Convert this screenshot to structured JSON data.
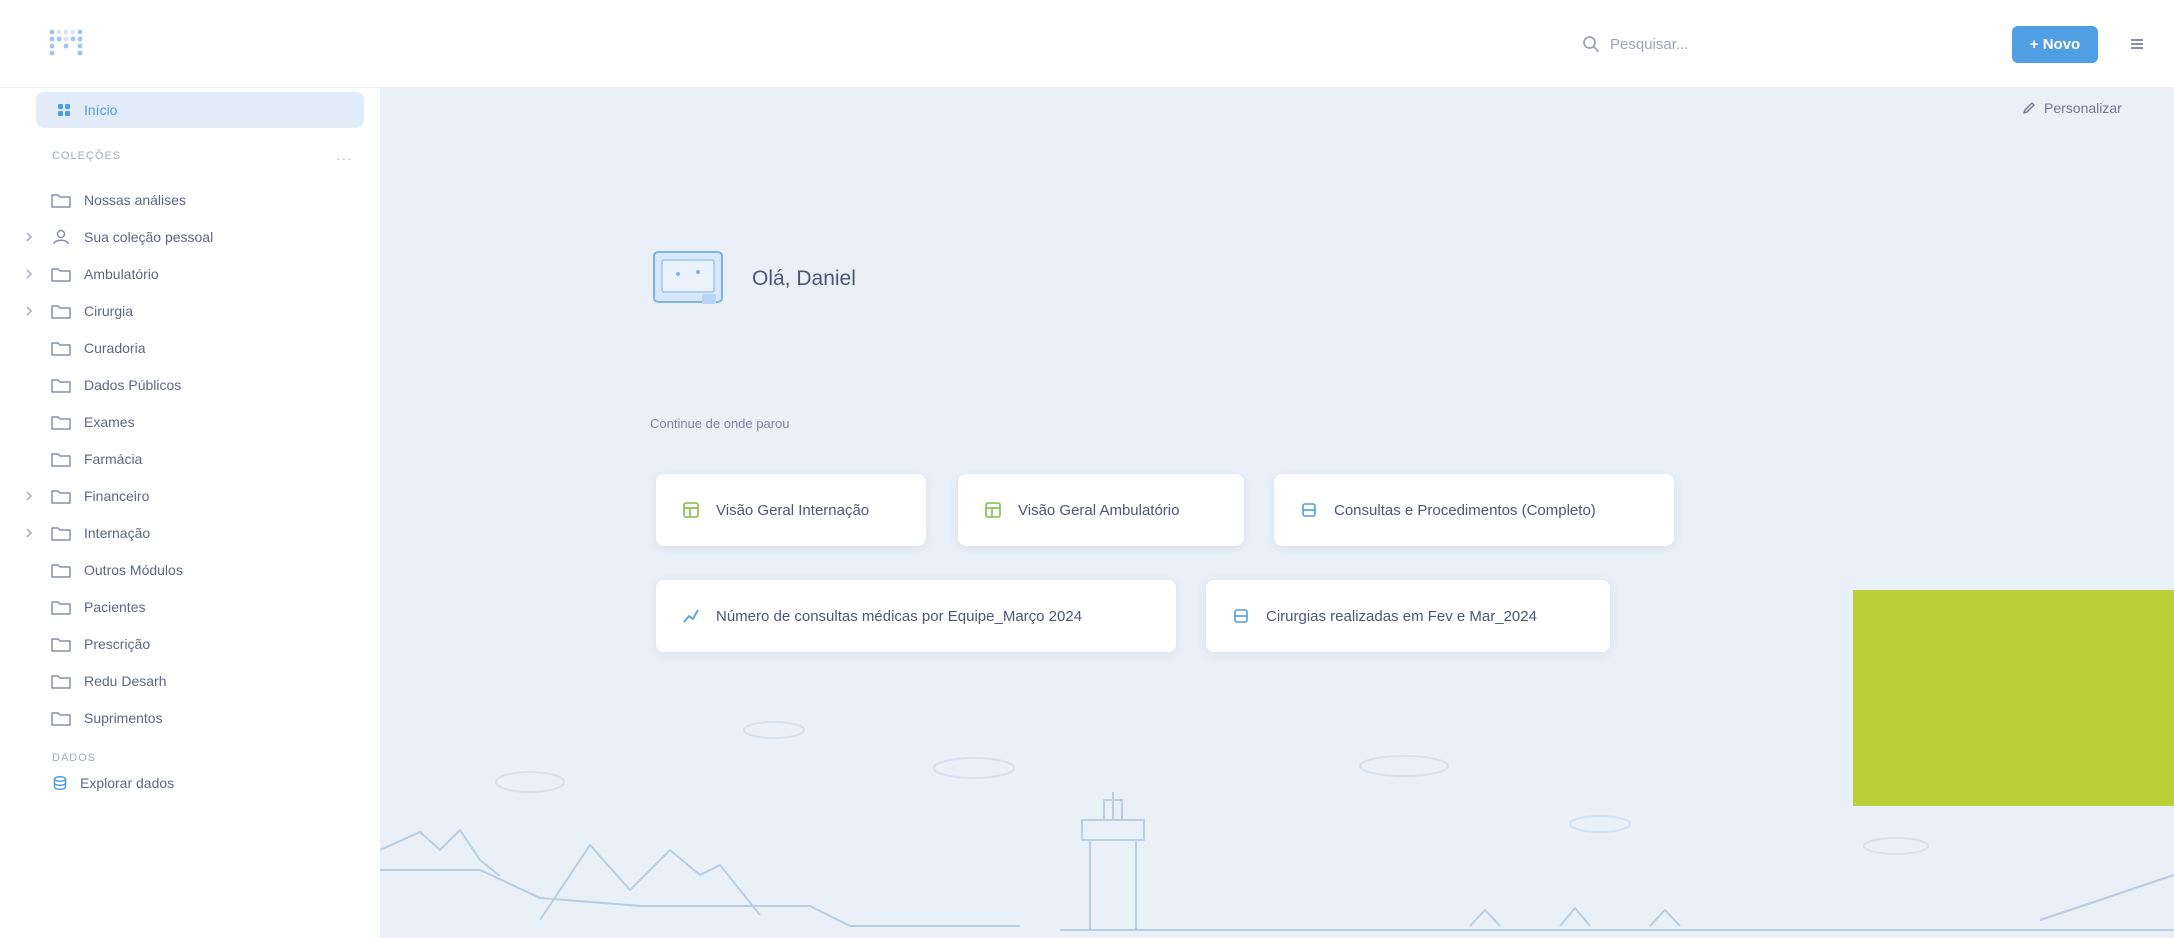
{
  "header": {
    "logo": "metabase-logo-icon",
    "search_placeholder": "Pesquisar...",
    "new_button_label": "+ Novo",
    "menu_icon": "menu-dots-icon"
  },
  "sidebar": {
    "home_label": "Início",
    "collections_label": "COLEÇÕES",
    "collections_more": "···",
    "collections": [
      {
        "label": "Nossas análises",
        "has_children": false,
        "icon": "folder-icon"
      },
      {
        "label": "Sua coleção pessoal",
        "has_children": true,
        "icon": "person-icon"
      },
      {
        "label": "Ambulatório",
        "has_children": true,
        "icon": "folder-icon"
      },
      {
        "label": "Cirurgia",
        "has_children": true,
        "icon": "folder-icon"
      },
      {
        "label": "Curadoria",
        "has_children": false,
        "icon": "folder-icon"
      },
      {
        "label": "Dados Públicos",
        "has_children": false,
        "icon": "folder-icon"
      },
      {
        "label": "Exames",
        "has_children": false,
        "icon": "folder-icon"
      },
      {
        "label": "Farmácia",
        "has_children": false,
        "icon": "folder-icon"
      },
      {
        "label": "Financeiro",
        "has_children": true,
        "icon": "folder-icon"
      },
      {
        "label": "Internação",
        "has_children": true,
        "icon": "folder-icon"
      },
      {
        "label": "Outros Módulos",
        "has_children": false,
        "icon": "folder-icon"
      },
      {
        "label": "Pacientes",
        "has_children": false,
        "icon": "folder-icon"
      },
      {
        "label": "Prescrição",
        "has_children": false,
        "icon": "folder-icon"
      },
      {
        "label": "Redu Desarh",
        "has_children": false,
        "icon": "folder-icon"
      },
      {
        "label": "Suprimentos",
        "has_children": false,
        "icon": "folder-icon"
      }
    ],
    "data_label": "DADOS",
    "explore_label": "Explorar dados"
  },
  "main": {
    "personalize_label": "Personalizar",
    "greeting": "Olá, Daniel",
    "continue_label": "Continue de onde parou",
    "cards": [
      {
        "label": "Visão Geral Internação",
        "icon": "dashboard-icon"
      },
      {
        "label": "Visão Geral Ambulatório",
        "icon": "dashboard-icon"
      },
      {
        "label": "Consultas e Procedimentos (Completo)",
        "icon": "table-icon"
      },
      {
        "label": "Número de consultas médicas por Equipe_Março 2024",
        "icon": "line-chart-icon"
      },
      {
        "label": "Cirurgias realizadas em Fev e Mar_2024",
        "icon": "table-icon"
      }
    ]
  },
  "colors": {
    "brand": "#509ee3",
    "highlight_block": "#b9d03a",
    "background": "#e9f0f8"
  }
}
